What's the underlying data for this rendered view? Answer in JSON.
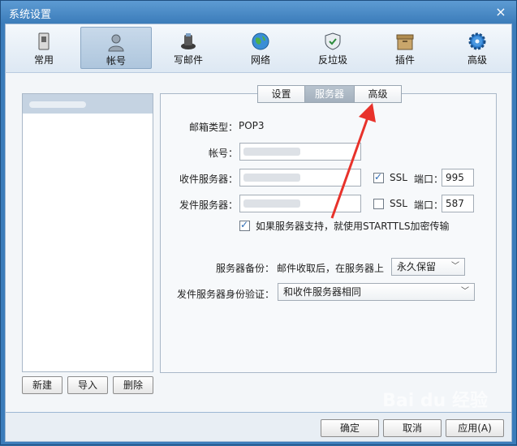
{
  "window": {
    "title": "系统设置",
    "close": "×"
  },
  "toolbar": {
    "items": [
      {
        "label": "常用",
        "icon": "device-icon"
      },
      {
        "label": "帐号",
        "icon": "user-icon"
      },
      {
        "label": "写邮件",
        "icon": "compose-icon"
      },
      {
        "label": "网络",
        "icon": "globe-icon"
      },
      {
        "label": "反垃圾",
        "icon": "shield-icon"
      },
      {
        "label": "插件",
        "icon": "box-icon"
      },
      {
        "label": "高级",
        "icon": "gear-icon"
      }
    ],
    "active_index": 1
  },
  "left": {
    "buttons": {
      "new": "新建",
      "import": "导入",
      "delete": "删除"
    }
  },
  "tabs": {
    "settings": "设置",
    "server": "服务器",
    "advanced": "高级"
  },
  "form": {
    "mailbox_type_label": "邮箱类型：",
    "mailbox_type_value": "POP3",
    "account_label": "帐号：",
    "incoming_label": "收件服务器：",
    "outgoing_label": "发件服务器：",
    "ssl_label": "SSL",
    "port_label": "端口：",
    "incoming_port": "995",
    "outgoing_port": "587",
    "incoming_ssl_checked": true,
    "outgoing_ssl_checked": false,
    "starttls_label": "如果服务器支持，就使用STARTTLS加密传输",
    "starttls_checked": true,
    "backup_label": "服务器备份：",
    "backup_desc": "邮件收取后，在服务器上",
    "backup_value": "永久保留",
    "auth_label": "发件服务器身份验证：",
    "auth_value": "和收件服务器相同"
  },
  "footer": {
    "ok": "确定",
    "cancel": "取消",
    "apply": "应用(A)"
  },
  "watermark": "Bai du 经验",
  "colors": {
    "accent": "#3b7cba",
    "arrow": "#e8322b"
  }
}
